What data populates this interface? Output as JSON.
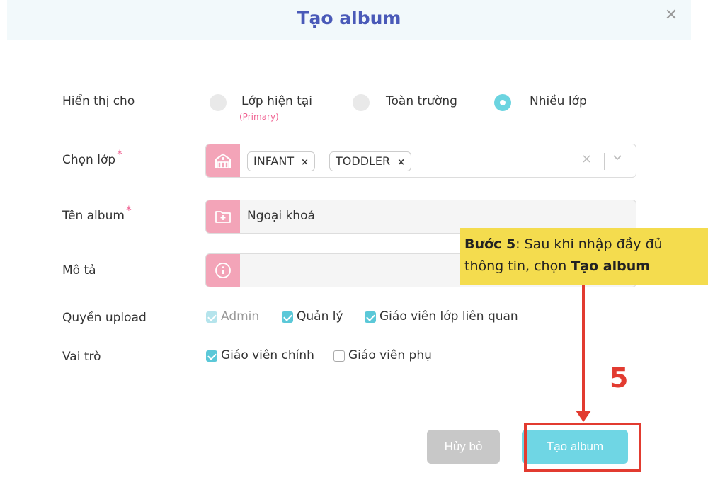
{
  "modal": {
    "title": "Tạo album"
  },
  "display_for": {
    "label": "Hiển thị cho",
    "options": [
      {
        "label": "Lớp hiện tại",
        "sublabel": "(Primary)",
        "selected": false
      },
      {
        "label": "Toàn trường",
        "selected": false
      },
      {
        "label": "Nhiều lớp",
        "selected": true
      }
    ]
  },
  "class_select": {
    "label": "Chọn lớp",
    "required_mark": "*",
    "tags": [
      "INFANT",
      "TODDLER"
    ],
    "tag_remove": "×",
    "clear": "×",
    "chevron": "⌄"
  },
  "album_name": {
    "label": "Tên album",
    "required_mark": "*",
    "value": "Ngoại khoá"
  },
  "description": {
    "label": "Mô tả",
    "value": ""
  },
  "upload_permission": {
    "label": "Quyền upload",
    "options": [
      {
        "label": "Admin",
        "checked": true,
        "disabled": true
      },
      {
        "label": "Quản lý",
        "checked": true,
        "disabled": false
      },
      {
        "label": "Giáo viên lớp liên quan",
        "checked": true,
        "disabled": false
      }
    ]
  },
  "role": {
    "label": "Vai trò",
    "options": [
      {
        "label": "Giáo viên chính",
        "checked": true
      },
      {
        "label": "Giáo viên phụ",
        "checked": false
      }
    ]
  },
  "buttons": {
    "cancel": "Hủy bỏ",
    "create": "Tạo album"
  },
  "annotation": {
    "step_bold": "Bước 5",
    "text": ": Sau khi nhập đầy đủ thông tin, chọn ",
    "action_bold": "Tạo album",
    "step_number": "5"
  },
  "colors": {
    "accent": "#6fd6e4",
    "title": "#4a5ab8",
    "icon_bg": "#f3a4b8",
    "annotation_red": "#e23b30",
    "callout_bg": "#f4dc4e"
  }
}
